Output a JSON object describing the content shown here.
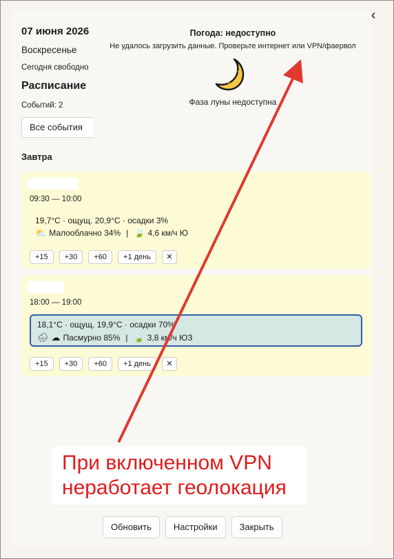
{
  "window": {
    "minimize": "—",
    "maximize": "☐",
    "close": "✕"
  },
  "left": {
    "date": "07 июня 2026",
    "weekday": "Воскресенье",
    "free": "Сегодня свободно",
    "schedule_title": "Расписание",
    "events_count": "Событий: 2",
    "filter_value": "Все события"
  },
  "weather": {
    "title": "Погода: недоступно",
    "error": "Не удалось загрузить данные. Проверьте интернет или VPN/фаервол",
    "moon_icon": "crescent-moon-icon",
    "moon_text": "Фаза луны недоступна"
  },
  "tomorrow_label": "Завтра",
  "events": [
    {
      "time": "09:30 — 10:00",
      "weather_line1": "19,7°C · ощущ. 20,9°C · осадки 3%",
      "sky": "Малооблачно 34%",
      "separator": "|",
      "wind": "4,6 км/ч Ю",
      "highlighted": false
    },
    {
      "time": "18:00 — 19:00",
      "weather_line1": "18,1°C · ощущ. 19,9°C · осадки 70%",
      "sky": "Пасмурно 85%",
      "separator": "|",
      "wind": "3,8 км/ч ЮЗ",
      "highlighted": true
    }
  ],
  "snooze_buttons": [
    "+15",
    "+30",
    "+60",
    "+1 день",
    "✕"
  ],
  "annotation": {
    "line1": "При включенном VPN",
    "line2": "неработает геолокация",
    "color": "#e01b1b"
  },
  "bottom_buttons": {
    "refresh": "Обновить",
    "settings": "Настройки",
    "close": "Закрыть"
  }
}
